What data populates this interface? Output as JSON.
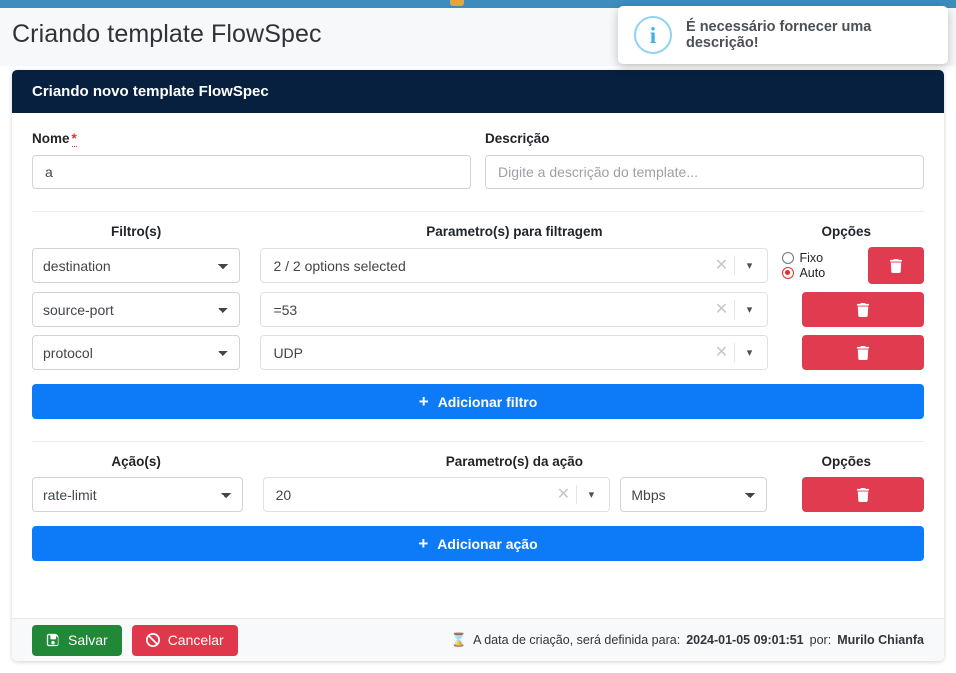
{
  "topbar": {
    "logo_icon": "app-logo-icon"
  },
  "page": {
    "title": "Criando template FlowSpec"
  },
  "toast": {
    "icon": "info-circle-icon",
    "message": "É necessário fornecer uma descrição!"
  },
  "card": {
    "header_title": "Criando novo template FlowSpec",
    "name": {
      "label": "Nome",
      "required_marker": "*",
      "value": "a"
    },
    "description": {
      "label": "Descrição",
      "value": "",
      "placeholder": "Digite a descrição do template..."
    },
    "filters_section": {
      "col_filter": "Filtro(s)",
      "col_param": "Parametro(s) para filtragem",
      "col_options": "Opções",
      "rows": [
        {
          "filter": "destination",
          "param": "2 / 2 options selected",
          "clear_icon": "clear-x-icon",
          "caret_icon": "chevron-down-icon",
          "radio_fixo": "Fixo",
          "radio_auto": "Auto",
          "selected_mode": "Auto",
          "delete_icon": "trash-icon"
        },
        {
          "filter": "source-port",
          "param": "=53",
          "clear_icon": "clear-x-icon",
          "caret_icon": "chevron-down-icon",
          "delete_icon": "trash-icon"
        },
        {
          "filter": "protocol",
          "param": "UDP",
          "clear_icon": "clear-x-icon",
          "caret_icon": "chevron-down-icon",
          "delete_icon": "trash-icon"
        }
      ],
      "add_button": "Adicionar filtro",
      "add_icon": "plus-icon"
    },
    "actions_section": {
      "col_action": "Ação(s)",
      "col_param": "Parametro(s) da ação",
      "col_options": "Opções",
      "rows": [
        {
          "action": "rate-limit",
          "param": "20",
          "clear_icon": "clear-x-icon",
          "caret_icon": "chevron-down-icon",
          "unit": "Mbps",
          "delete_icon": "trash-icon"
        }
      ],
      "add_button": "Adicionar ação",
      "add_icon": "plus-icon"
    },
    "footer": {
      "save_label": "Salvar",
      "save_icon": "save-floppy-icon",
      "cancel_label": "Cancelar",
      "cancel_icon": "ban-icon",
      "hourglass_icon": "hourglass-icon",
      "note_prefix": "A data de criação, será definida para:",
      "note_datetime": "2024-01-05 09:01:51",
      "note_by": "por:",
      "note_user": "Murilo Chianfa"
    }
  },
  "colors": {
    "topbar": "#3d8dbc",
    "card_header": "#072040",
    "primary_blue": "#0d7bf7",
    "danger_red": "#e03b4e",
    "success_green": "#218838",
    "info_blue": "#3bb3e8",
    "hourglass_teal": "#36b3c9"
  }
}
